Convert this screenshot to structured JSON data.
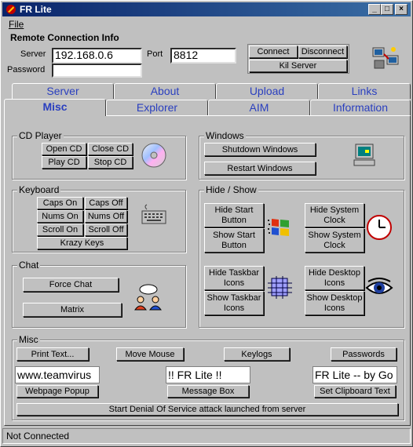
{
  "window": {
    "title": "FR Lite",
    "minimize": "_",
    "maximize": "□",
    "close": "×"
  },
  "menu": {
    "file": "File"
  },
  "connection": {
    "heading": "Remote Connection Info",
    "server_label": "Server",
    "server_value": "192.168.0.6",
    "port_label": "Port",
    "port_value": "8812",
    "password_label": "Password",
    "password_value": "",
    "connect": "Connect",
    "disconnect": "Disconnect",
    "kill_server": "Kil Server"
  },
  "tabs_row1": [
    "Server",
    "About",
    "Upload",
    "Links"
  ],
  "tabs_row2": [
    "Misc",
    "Explorer",
    "AIM",
    "Information"
  ],
  "cd_player": {
    "title": "CD Player",
    "open": "Open CD",
    "close": "Close CD",
    "play": "Play CD",
    "stop": "Stop CD"
  },
  "windows": {
    "title": "Windows",
    "shutdown": "Shutdown Windows",
    "restart": "Restart Windows"
  },
  "keyboard": {
    "title": "Keyboard",
    "caps_on": "Caps On",
    "caps_off": "Caps Off",
    "nums_on": "Nums On",
    "nums_off": "Nums Off",
    "scroll_on": "Scroll On",
    "scroll_off": "Scroll Off",
    "krazy": "Krazy Keys"
  },
  "hideshow": {
    "title": "Hide / Show",
    "hide_start": "Hide Start Button",
    "show_start": "Show Start Button",
    "hide_clock": "Hide System Clock",
    "show_clock": "Show System Clock",
    "hide_taskbar": "Hide Taskbar Icons",
    "show_taskbar": "Show Taskbar Icons",
    "hide_desktop": "Hide Desktop Icons",
    "show_desktop": "Show Desktop Icons"
  },
  "chat": {
    "title": "Chat",
    "force": "Force Chat",
    "matrix": "Matrix"
  },
  "misc": {
    "title": "Misc",
    "print": "Print Text...",
    "move_mouse": "Move Mouse",
    "keylogs": "Keylogs",
    "passwords": "Passwords",
    "webpage_value": "www.teamvirus",
    "webpage_btn": "Webpage Popup",
    "message_value": "!! FR Lite !!",
    "message_btn": "Message Box",
    "clipboard_value": "FR Lite -- by Go",
    "clipboard_btn": "Set Clipboard Text",
    "dos": "Start Denial Of Service attack launched from server"
  },
  "status": "Not Connected"
}
